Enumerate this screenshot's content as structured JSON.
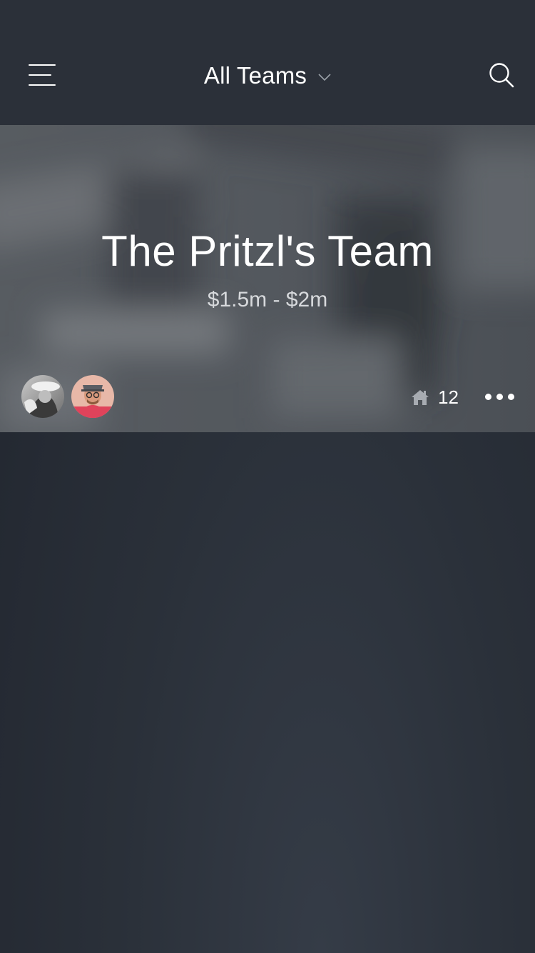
{
  "navbar": {
    "menu_icon": "hamburger-menu-icon",
    "team_selector_label": "All Teams",
    "chevron_icon": "chevron-down-icon",
    "search_icon": "search-icon"
  },
  "team_card": {
    "title": "The Pritzl's Team",
    "price_range": "$1.5m - $2m",
    "members": [
      {
        "avatar": "member-avatar-1"
      },
      {
        "avatar": "member-avatar-2"
      }
    ],
    "home_icon": "home-icon",
    "home_count": "12",
    "more_icon": "more-dots-icon"
  },
  "colors": {
    "nav_bg": "#2b3039",
    "page_bg": "#262b33",
    "text_primary": "#ffffff",
    "text_secondary": "#d7d9dc",
    "avatar2_accent": "#e0435b"
  }
}
